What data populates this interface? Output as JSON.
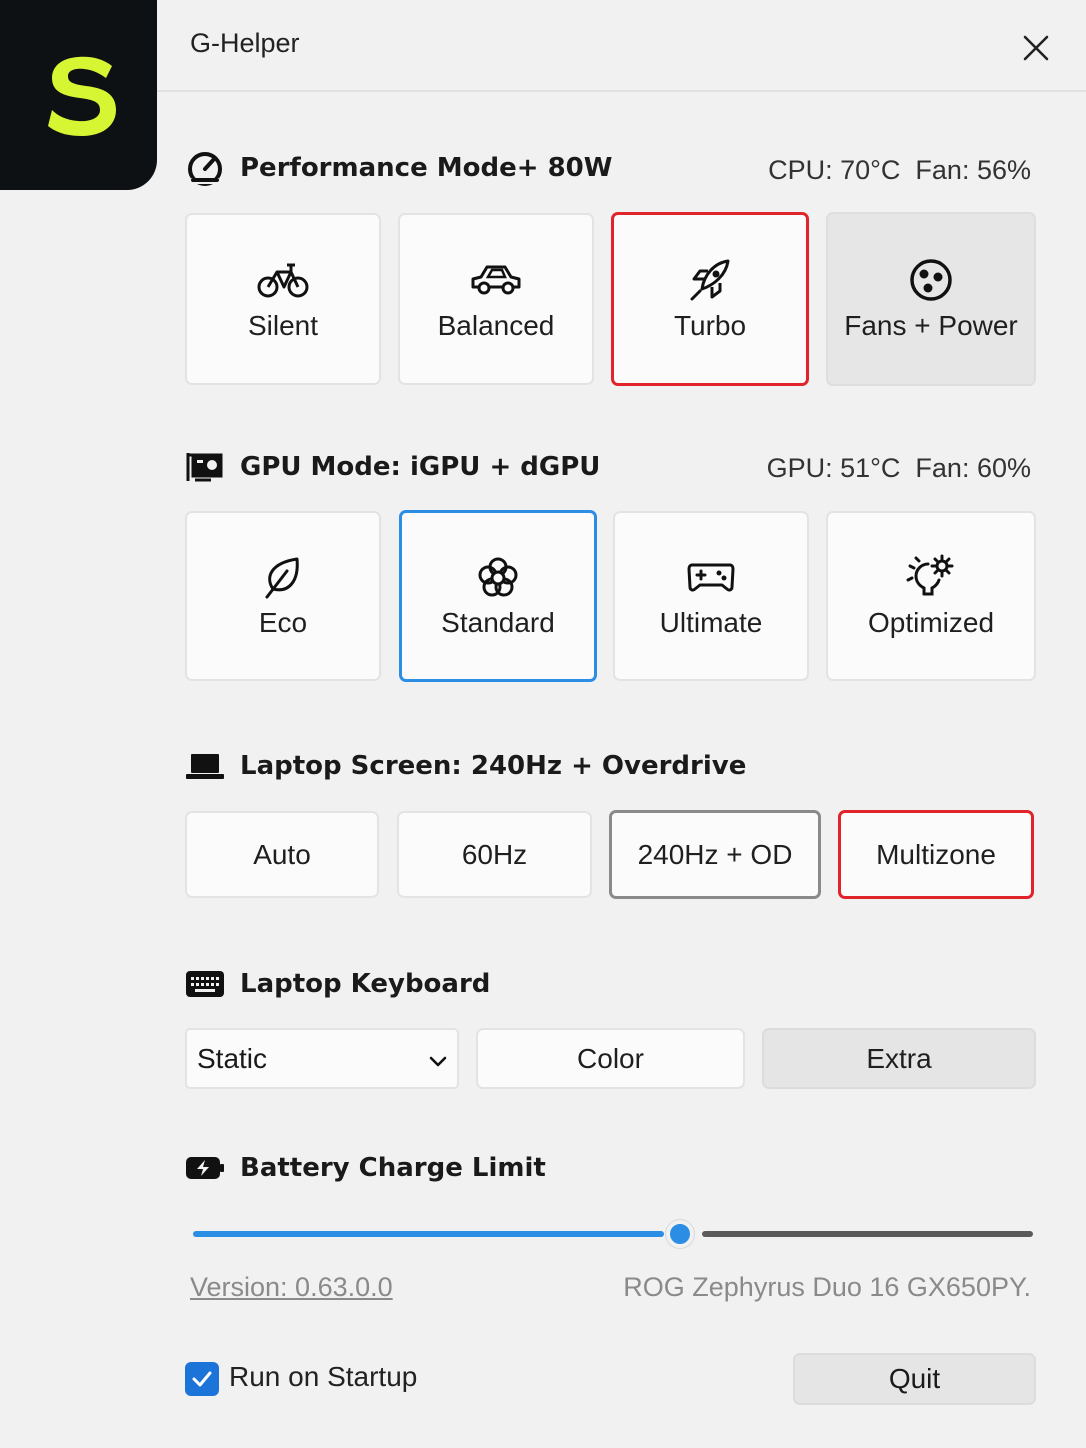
{
  "app": {
    "title": "G-Helper",
    "logo_letter": "S",
    "accent": "#d6f532"
  },
  "performance": {
    "heading": "Performance Mode+ 80W",
    "stats": "CPU: 70°C  Fan: 56%",
    "modes": [
      {
        "label": "Silent",
        "icon": "bicycle-icon"
      },
      {
        "label": "Balanced",
        "icon": "car-icon"
      },
      {
        "label": "Turbo",
        "icon": "rocket-icon",
        "selected": true
      },
      {
        "label": "Fans + Power",
        "icon": "fan-icon"
      }
    ]
  },
  "gpu": {
    "heading": "GPU Mode: iGPU + dGPU",
    "stats": "GPU: 51°C  Fan: 60%",
    "modes": [
      {
        "label": "Eco",
        "icon": "leaf-icon"
      },
      {
        "label": "Standard",
        "icon": "flower-icon",
        "selected": true
      },
      {
        "label": "Ultimate",
        "icon": "gamepad-icon"
      },
      {
        "label": "Optimized",
        "icon": "bulb-gear-icon"
      }
    ]
  },
  "screen": {
    "heading": "Laptop Screen: 240Hz + Overdrive",
    "modes": [
      "Auto",
      "60Hz",
      "240Hz + OD",
      "Multizone"
    ]
  },
  "keyboard": {
    "heading": "Laptop Keyboard",
    "mode_selected": "Static",
    "color_label": "Color",
    "extra_label": "Extra"
  },
  "battery": {
    "heading": "Battery Charge Limit",
    "limit_fraction": 0.58
  },
  "footer": {
    "version": "Version: 0.63.0.0",
    "model": "ROG Zephyrus Duo 16 GX650PY.",
    "startup_label": "Run on Startup",
    "startup_checked": true,
    "quit_label": "Quit"
  },
  "colors": {
    "red": "#e1232c",
    "blue": "#2b8de4",
    "checkbox": "#1c74d9"
  }
}
